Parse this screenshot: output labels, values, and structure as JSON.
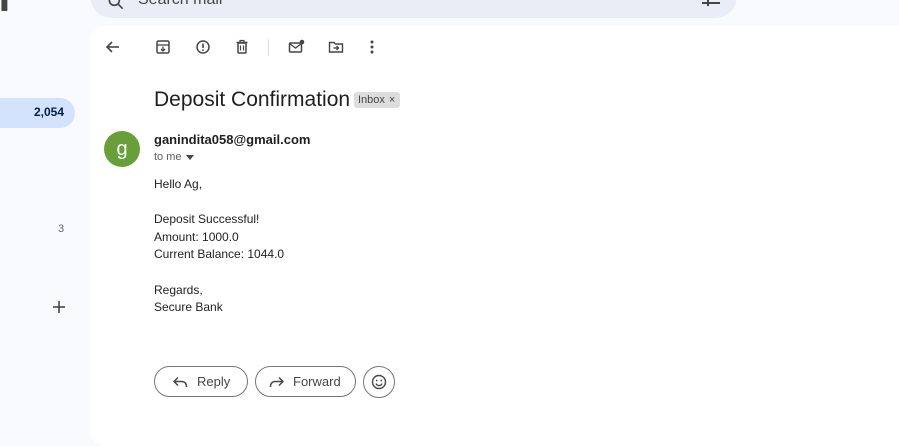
{
  "search": {
    "placeholder": "Search mail"
  },
  "sidebar": {
    "inbox_count": "2,054",
    "other_count": "3"
  },
  "toolbar": {
    "icons": [
      "back-arrow-icon",
      "archive-icon",
      "report-spam-icon",
      "delete-icon",
      "mark-unread-icon",
      "move-to-icon",
      "more-vert-icon"
    ]
  },
  "email": {
    "subject": "Deposit Confirmation",
    "label_chip": "Inbox",
    "label_remove": "×",
    "avatar_letter": "g",
    "sender": "ganindita058@gmail.com",
    "recipient": "to me",
    "body": {
      "greeting": "Hello Ag,",
      "line1": "Deposit Successful!",
      "line2": "Amount: 1000.0",
      "line3": "Current Balance: 1044.0",
      "signoff": "Regards,",
      "signature": "Secure Bank"
    }
  },
  "actions": {
    "reply": "Reply",
    "forward": "Forward"
  },
  "colors": {
    "avatar": "#689f38",
    "selected_nav": "#d3e3fd",
    "background": "#f8fafd"
  }
}
